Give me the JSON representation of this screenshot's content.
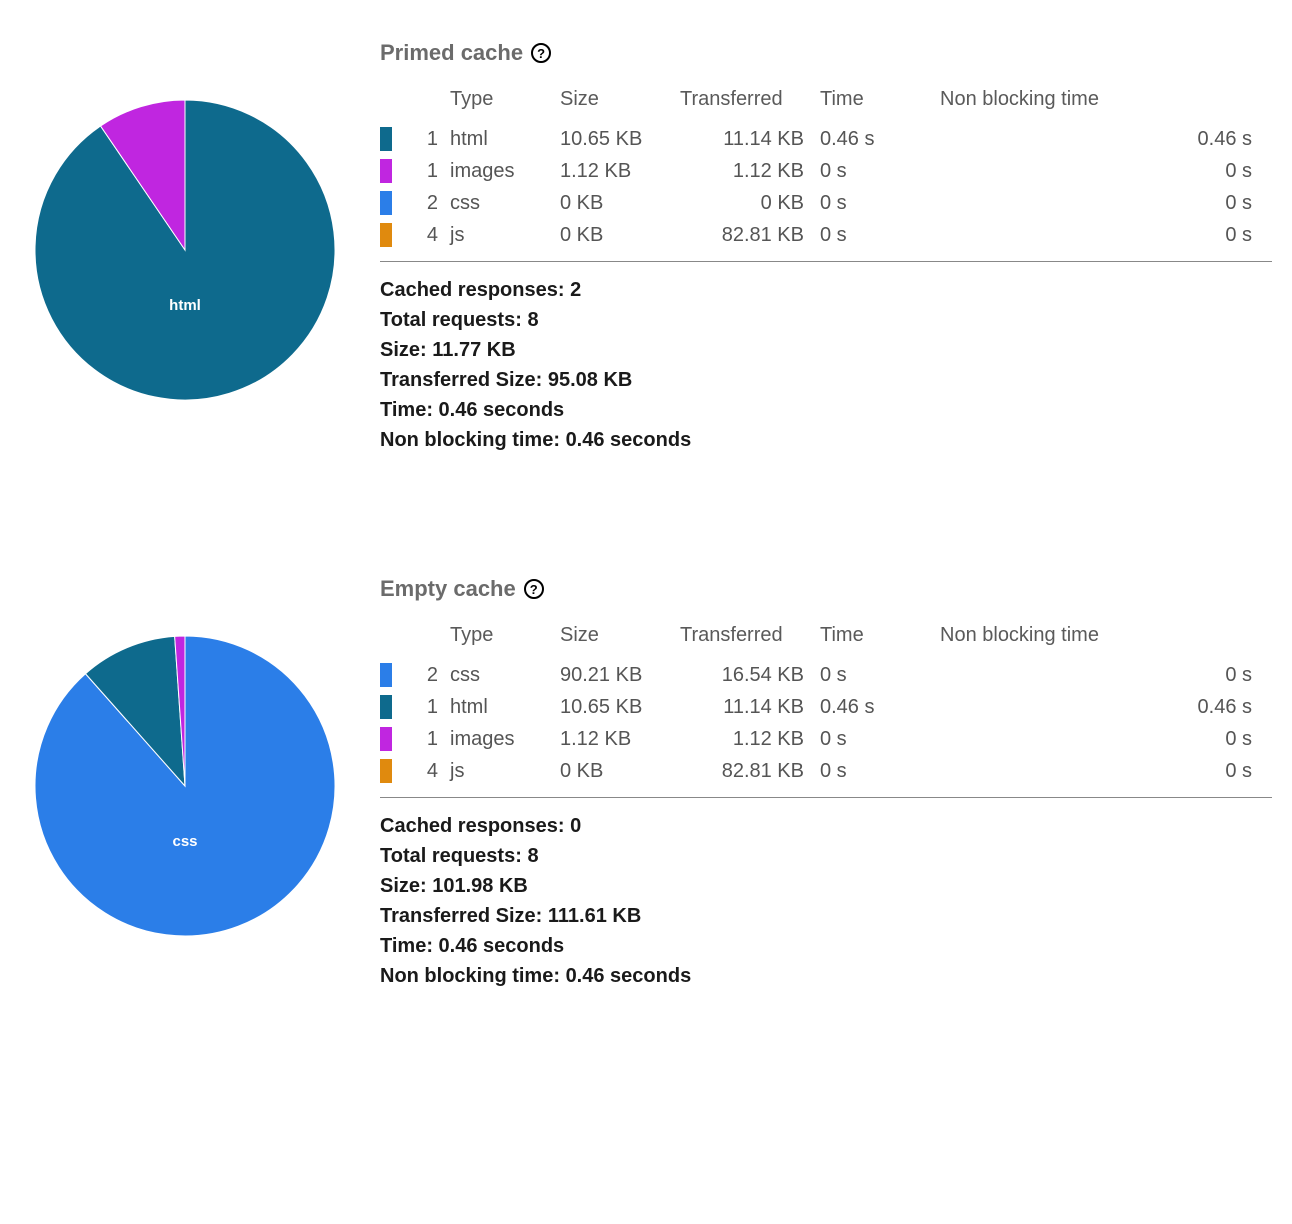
{
  "colors": {
    "html": "#0e6a8d",
    "images": "#c026e0",
    "css": "#2b7ee8",
    "js": "#e08a0e"
  },
  "headers": {
    "type": "Type",
    "size": "Size",
    "transferred": "Transferred",
    "time": "Time",
    "non_blocking": "Non blocking time"
  },
  "summary_labels": {
    "cached": "Cached responses:",
    "total": "Total requests:",
    "size": "Size:",
    "transferred": "Transferred Size:",
    "time": "Time:",
    "non_blocking": "Non blocking time:"
  },
  "sections": [
    {
      "title": "Primed cache",
      "pie_label": "html",
      "rows": [
        {
          "color_key": "html",
          "count": "1",
          "type": "html",
          "size": "10.65 KB",
          "transferred": "11.14 KB",
          "time": "0.46 s",
          "nb": "0.46 s"
        },
        {
          "color_key": "images",
          "count": "1",
          "type": "images",
          "size": "1.12 KB",
          "transferred": "1.12 KB",
          "time": "0 s",
          "nb": "0 s"
        },
        {
          "color_key": "css",
          "count": "2",
          "type": "css",
          "size": "0 KB",
          "transferred": "0 KB",
          "time": "0 s",
          "nb": "0 s"
        },
        {
          "color_key": "js",
          "count": "4",
          "type": "js",
          "size": "0 KB",
          "transferred": "82.81 KB",
          "time": "0 s",
          "nb": "0 s"
        }
      ],
      "summary": {
        "cached": "2",
        "total": "8",
        "size": "11.77 KB",
        "transferred": "95.08 KB",
        "time": "0.46 seconds",
        "non_blocking": "0.46 seconds"
      }
    },
    {
      "title": "Empty cache",
      "pie_label": "css",
      "rows": [
        {
          "color_key": "css",
          "count": "2",
          "type": "css",
          "size": "90.21 KB",
          "transferred": "16.54 KB",
          "time": "0 s",
          "nb": "0 s"
        },
        {
          "color_key": "html",
          "count": "1",
          "type": "html",
          "size": "10.65 KB",
          "transferred": "11.14 KB",
          "time": "0.46 s",
          "nb": "0.46 s"
        },
        {
          "color_key": "images",
          "count": "1",
          "type": "images",
          "size": "1.12 KB",
          "transferred": "1.12 KB",
          "time": "0 s",
          "nb": "0 s"
        },
        {
          "color_key": "js",
          "count": "4",
          "type": "js",
          "size": "0 KB",
          "transferred": "82.81 KB",
          "time": "0 s",
          "nb": "0 s"
        }
      ],
      "summary": {
        "cached": "0",
        "total": "8",
        "size": "101.98 KB",
        "transferred": "111.61 KB",
        "time": "0.46 seconds",
        "non_blocking": "0.46 seconds"
      }
    }
  ],
  "chart_data": [
    {
      "type": "pie",
      "title": "Primed cache — size by type (KB)",
      "categories": [
        "html",
        "images",
        "css",
        "js"
      ],
      "values": [
        10.65,
        1.12,
        0,
        0
      ],
      "colors": [
        "#0e6a8d",
        "#c026e0",
        "#2b7ee8",
        "#e08a0e"
      ],
      "dominant_label": "html"
    },
    {
      "type": "pie",
      "title": "Empty cache — size by type (KB)",
      "categories": [
        "css",
        "html",
        "images",
        "js"
      ],
      "values": [
        90.21,
        10.65,
        1.12,
        0
      ],
      "colors": [
        "#2b7ee8",
        "#0e6a8d",
        "#c026e0",
        "#e08a0e"
      ],
      "dominant_label": "css"
    }
  ]
}
